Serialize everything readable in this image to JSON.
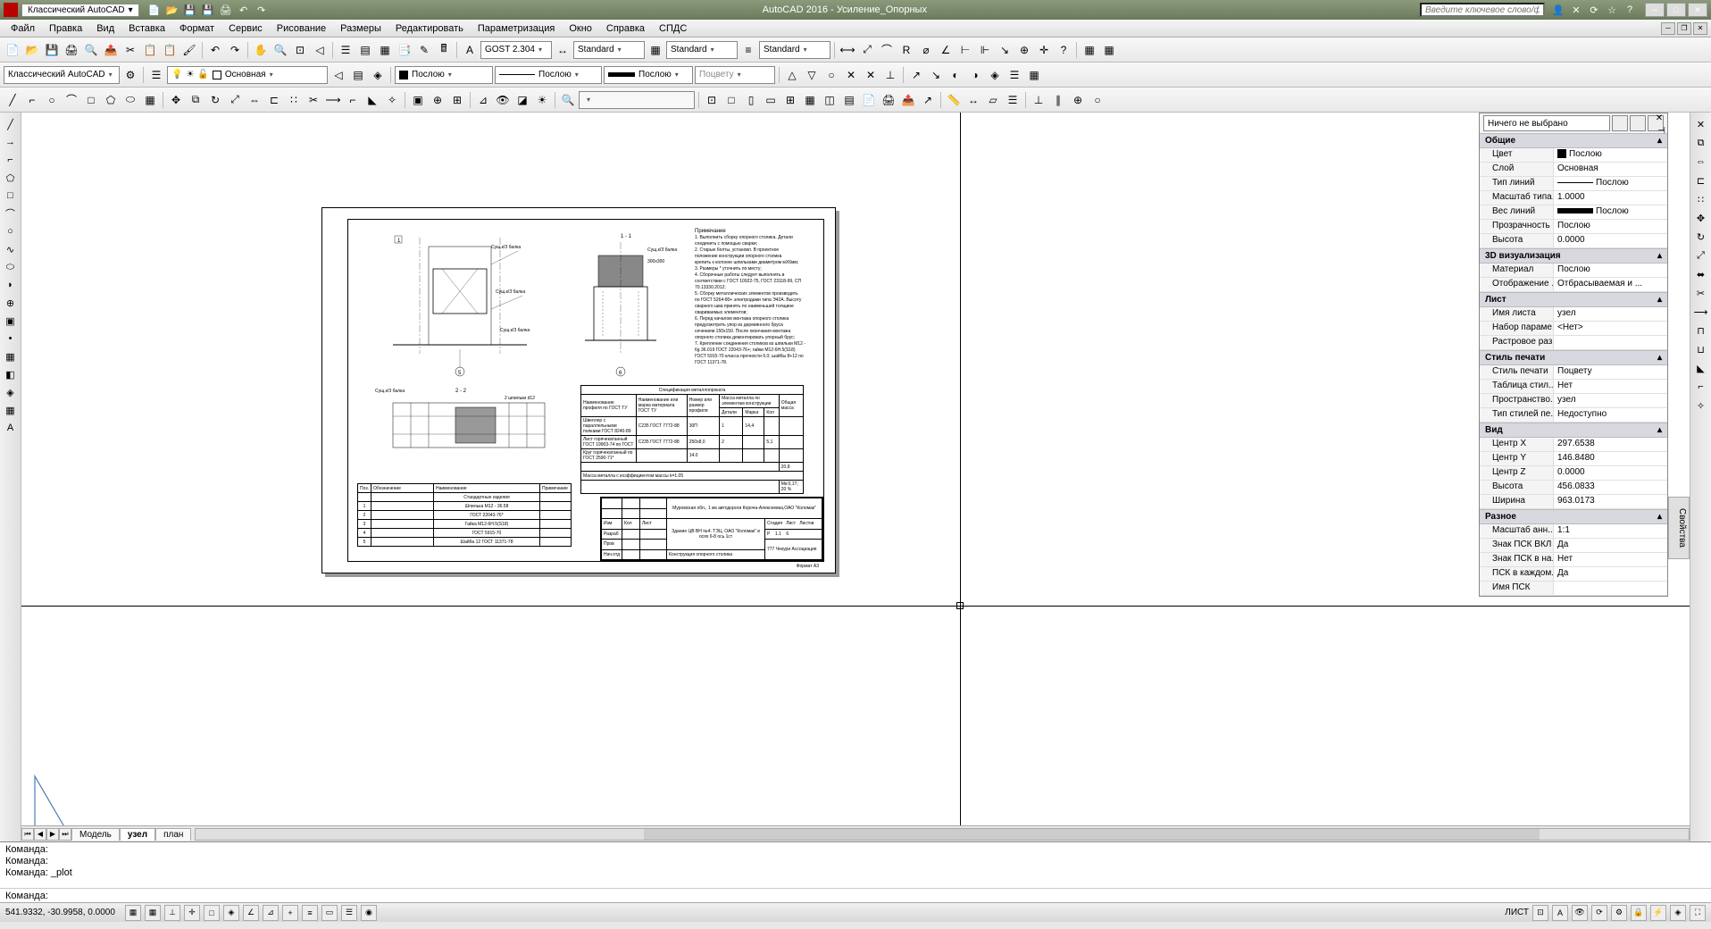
{
  "titlebar": {
    "workspace": "Классический AutoCAD",
    "title": "AutoCAD 2016 - Усиление_Опорных",
    "search_placeholder": "Введите ключевое слово/фразу"
  },
  "menu": [
    "Файл",
    "Правка",
    "Вид",
    "Вставка",
    "Формат",
    "Сервис",
    "Рисование",
    "Размеры",
    "Редактировать",
    "Параметризация",
    "Окно",
    "Справка",
    "СПДС"
  ],
  "toolbar": {
    "text_style": "GOST 2.304",
    "dim_style": "Standard",
    "table_style": "Standard",
    "ml_style": "Standard",
    "workspace": "Классический AutoCAD",
    "layer": "Основная",
    "color": "Послою",
    "linetype": "Послою",
    "lineweight": "Послою",
    "plot_style": "Поцвету"
  },
  "props": {
    "selector": "Ничего не выбрано",
    "sections": {
      "general": {
        "title": "Общие",
        "rows": [
          {
            "label": "Цвет",
            "value": "Послою",
            "swatch": "#000"
          },
          {
            "label": "Слой",
            "value": "Основная"
          },
          {
            "label": "Тип линий",
            "value": "Послою",
            "line": true
          },
          {
            "label": "Масштаб типа...",
            "value": "1.0000"
          },
          {
            "label": "Вес линий",
            "value": "Послою",
            "thick": true
          },
          {
            "label": "Прозрачность",
            "value": "Послою"
          },
          {
            "label": "Высота",
            "value": "0.0000"
          }
        ]
      },
      "viz3d": {
        "title": "3D визуализация",
        "rows": [
          {
            "label": "Материал",
            "value": "Послою"
          },
          {
            "label": "Отображение ...",
            "value": "Отбрасываемая и ..."
          }
        ]
      },
      "sheet": {
        "title": "Лист",
        "rows": [
          {
            "label": "Имя листа",
            "value": "узел"
          },
          {
            "label": "Набор параме...",
            "value": "<Нет>"
          },
          {
            "label": "Растровое раз...",
            "value": ""
          }
        ]
      },
      "plot": {
        "title": "Стиль печати",
        "rows": [
          {
            "label": "Стиль печати",
            "value": "Поцвету"
          },
          {
            "label": "Таблица стил...",
            "value": "Нет"
          },
          {
            "label": "Пространство...",
            "value": "узел"
          },
          {
            "label": "Тип стилей пе...",
            "value": "Недоступно"
          }
        ]
      },
      "view": {
        "title": "Вид",
        "rows": [
          {
            "label": "Центр X",
            "value": "297.6538"
          },
          {
            "label": "Центр Y",
            "value": "146.8480"
          },
          {
            "label": "Центр Z",
            "value": "0.0000"
          },
          {
            "label": "Высота",
            "value": "456.0833"
          },
          {
            "label": "Ширина",
            "value": "963.0173"
          }
        ]
      },
      "misc": {
        "title": "Разное",
        "rows": [
          {
            "label": "Масштаб анн...",
            "value": "1:1"
          },
          {
            "label": "Знак ПСК ВКЛ",
            "value": "Да"
          },
          {
            "label": "Знак ПСК в на...",
            "value": "Нет"
          },
          {
            "label": "ПСК в каждом...",
            "value": "Да"
          },
          {
            "label": "Имя ПСК",
            "value": ""
          }
        ]
      }
    },
    "side_tab": "Свойства"
  },
  "layout_tabs": {
    "tabs": [
      "Модель",
      "узел",
      "план"
    ],
    "active": 1
  },
  "cmd": {
    "history": [
      "Команда:",
      "Команда:",
      "Команда: _plot"
    ],
    "prompt": "Команда:"
  },
  "statusbar": {
    "coords": "541.9332, -30.9958, 0.0000",
    "sheet_label": "ЛИСТ"
  },
  "drawing": {
    "notes_title": "Примечание",
    "notes": [
      "1. Выполнить сборку опорного столика. Детали",
      "соединить с помощью сварки;",
      "2. Старые болты, установл. В проектное",
      "положение конструкции опорного столика",
      "крепить к колонне шпильками диаметром мХ6мм;",
      "3. Размеры * уточнить по месту;",
      "4. Сборочные работы следует выполнять в",
      "соответствии с ГОСТ 10922-75, ГОСТ 23118-99, СП",
      "70.13330.2012;",
      "5. Сборку металлических элементов производить",
      "по ГОСТ 5264-80+ электродами типа Э42А. Высоту",
      "сварного шва принять по наименьшей толщине",
      "свариваемых элементов;",
      "6. Перед началом монтажа опорного столика",
      "предусмотреть упор из деревянного бруса",
      "сечением 150х150. После окончания монтажа",
      "опорного столика демонтировать упорный брус;",
      "7. Крепление соединения столиков из шпильки М12 -",
      "6g 36.019 ГОСТ 22043-76+; гайки М12-6Н.5(S18)",
      "ГОСТ 5915-70 класса прочности 6.0; шайбы 8+12 по",
      "ГОСТ 11371-78."
    ],
    "spec_title": "Спецификация металлопроката",
    "bom_headers": [
      "Поз.",
      "Обозначение",
      "Наименование",
      "Примечание"
    ],
    "bom_rows": [
      [
        "",
        "",
        "Стандартные изделия",
        ""
      ],
      [
        "1",
        "",
        "Шпилька М12 - 36.58",
        ""
      ],
      [
        "2",
        "",
        "ГОСТ 22043-76*",
        ""
      ],
      [
        "3",
        "",
        "Гайка М12-6Н.5(S18)",
        ""
      ],
      [
        "4",
        "",
        "ГОСТ 5915-70",
        ""
      ],
      [
        "5",
        "",
        "Шайба 12 ГОСТ 11371-78",
        ""
      ]
    ],
    "title_text": "Конструкция опорного столика",
    "format": "Формат     А3"
  }
}
